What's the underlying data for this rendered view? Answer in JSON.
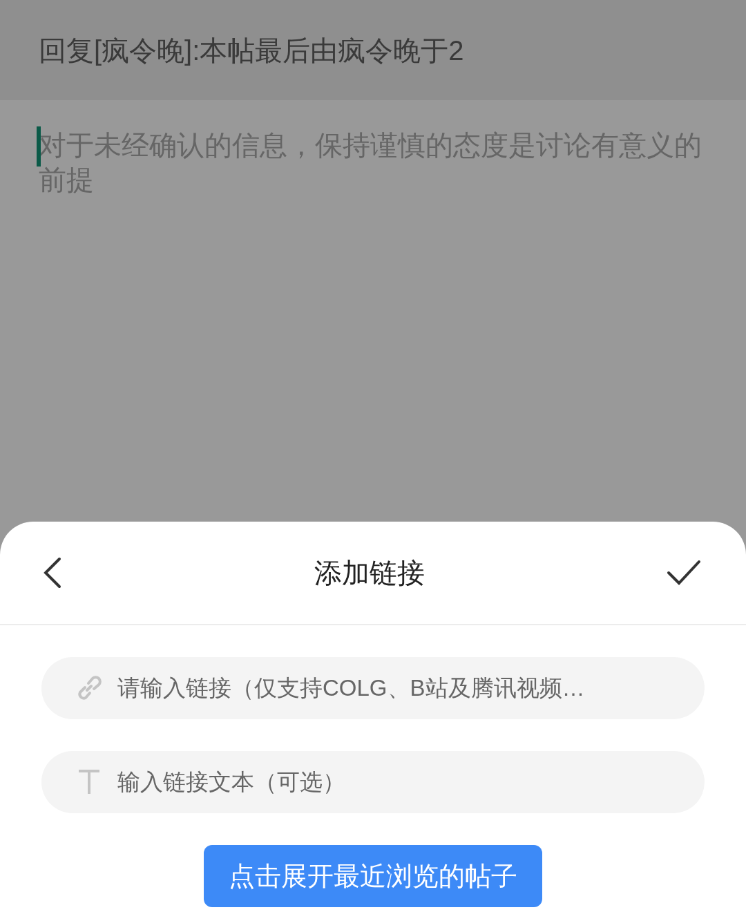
{
  "editor": {
    "title": "回复[疯令晚]:本帖最后由疯令晚于2",
    "body": "对于未经确认的信息，保持谨慎的态度是讨论有意义的前提"
  },
  "sheet": {
    "title": "添加链接",
    "fields": [
      {
        "kind": "link",
        "placeholder": "请输入链接（仅支持COLG、B站及腾讯视频…"
      },
      {
        "kind": "text",
        "placeholder": "输入链接文本（可选）"
      }
    ],
    "recent_button": "点击展开最近浏览的帖子"
  }
}
